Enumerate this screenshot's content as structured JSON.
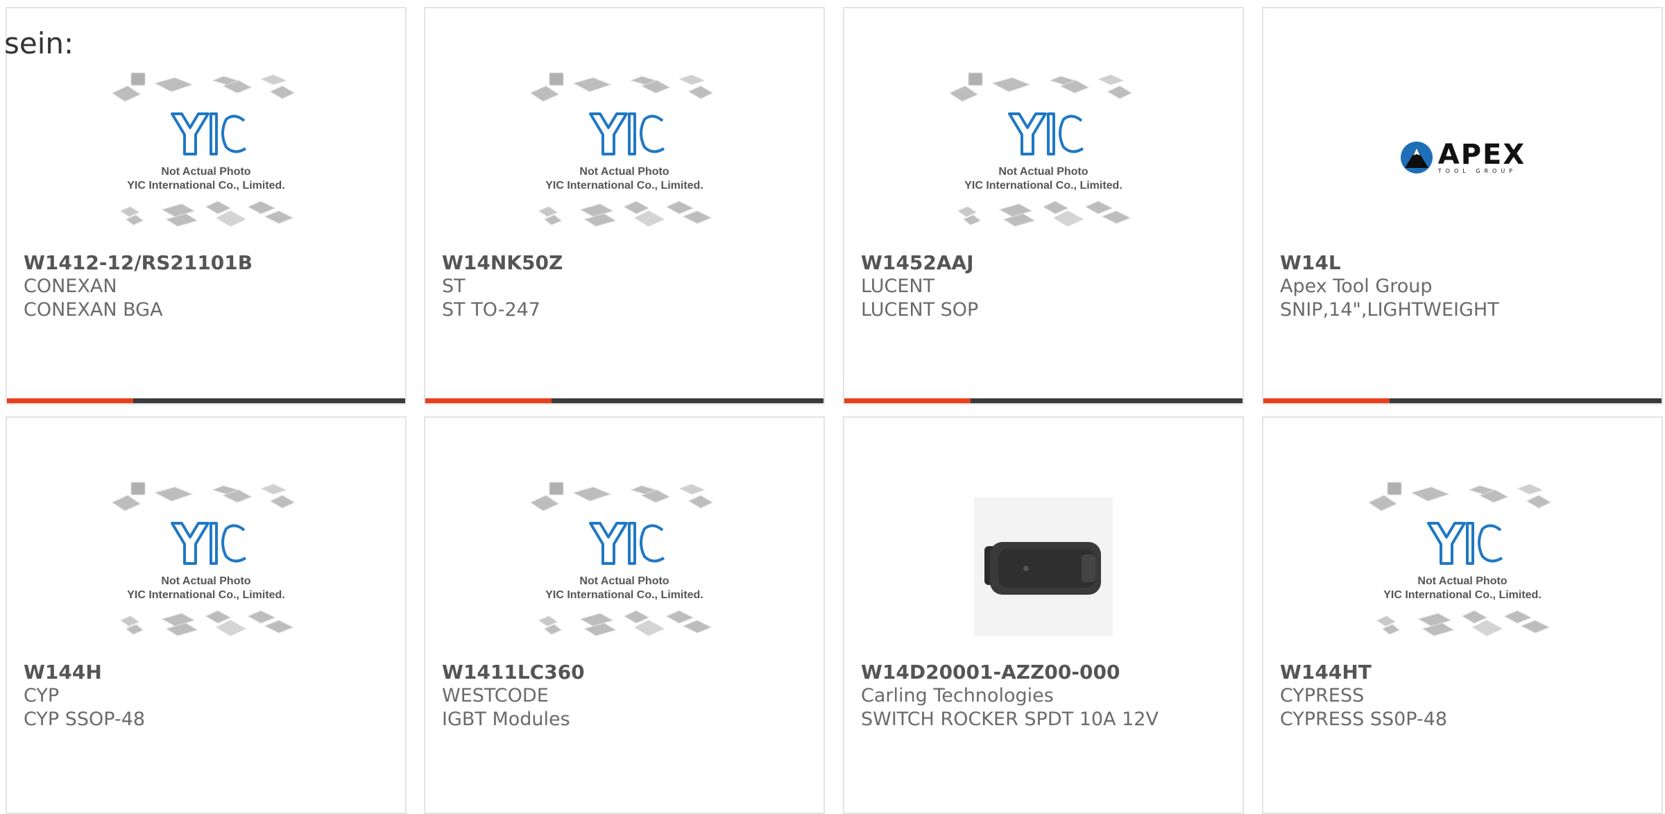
{
  "intro_text": "sein:",
  "placeholder": {
    "line1": "Not Actual Photo",
    "line2": "YIC International Co., Limited.",
    "logo": "YIC"
  },
  "apex_logo": {
    "main": "APEX",
    "sub": "TOOL GROUP"
  },
  "colors": {
    "accent": "#e8401c",
    "bar": "#3c3c3c",
    "logo_blue": "#1f78c4"
  },
  "products": [
    {
      "part": "W1412-12/RS21101B",
      "manufacturer": "CONEXAN",
      "description": "CONEXAN BGA",
      "image": "placeholder"
    },
    {
      "part": "W14NK50Z",
      "manufacturer": "ST",
      "description": "ST TO-247",
      "image": "placeholder"
    },
    {
      "part": "W1452AAJ",
      "manufacturer": "LUCENT",
      "description": "LUCENT SOP",
      "image": "placeholder"
    },
    {
      "part": "W14L",
      "manufacturer": "Apex Tool Group",
      "description": "SNIP,14\",LIGHTWEIGHT",
      "image": "apex-logo"
    },
    {
      "part": "W144H",
      "manufacturer": "CYP",
      "description": "CYP SSOP-48",
      "image": "placeholder"
    },
    {
      "part": "W1411LC360",
      "manufacturer": "WESTCODE",
      "description": "IGBT Modules",
      "image": "placeholder"
    },
    {
      "part": "W14D20001-AZZ00-000",
      "manufacturer": "Carling Technologies",
      "description": "SWITCH ROCKER SPDT 10A 12V",
      "image": "rocker-switch-photo"
    },
    {
      "part": "W144HT",
      "manufacturer": "CYPRESS",
      "description": "CYPRESS SS0P-48",
      "image": "placeholder"
    }
  ]
}
